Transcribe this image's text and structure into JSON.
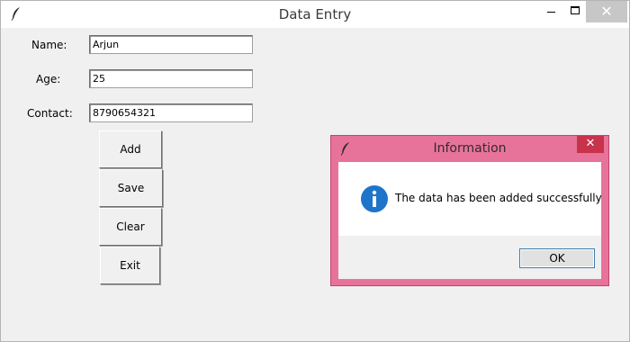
{
  "window": {
    "title": "Data Entry",
    "icons": {
      "app": "feather-icon",
      "minimize": "minimize-icon",
      "maximize": "maximize-icon",
      "close": "close-icon"
    },
    "close_glyph": "✕"
  },
  "form": {
    "name_label": "Name:",
    "name_value": "Arjun",
    "age_label": "Age:",
    "age_value": "25",
    "contact_label": "Contact:",
    "contact_value": "8790654321"
  },
  "buttons": {
    "add": "Add",
    "save": "Save",
    "clear": "Clear",
    "exit": "Exit"
  },
  "dialog": {
    "title": "Information",
    "close_glyph": "✕",
    "message": "The data has been added successfully",
    "ok": "OK",
    "icon": "info-icon"
  },
  "colors": {
    "dialog_frame": "#e8739a",
    "dialog_close": "#c8324b",
    "info_blue": "#1e74c8"
  }
}
